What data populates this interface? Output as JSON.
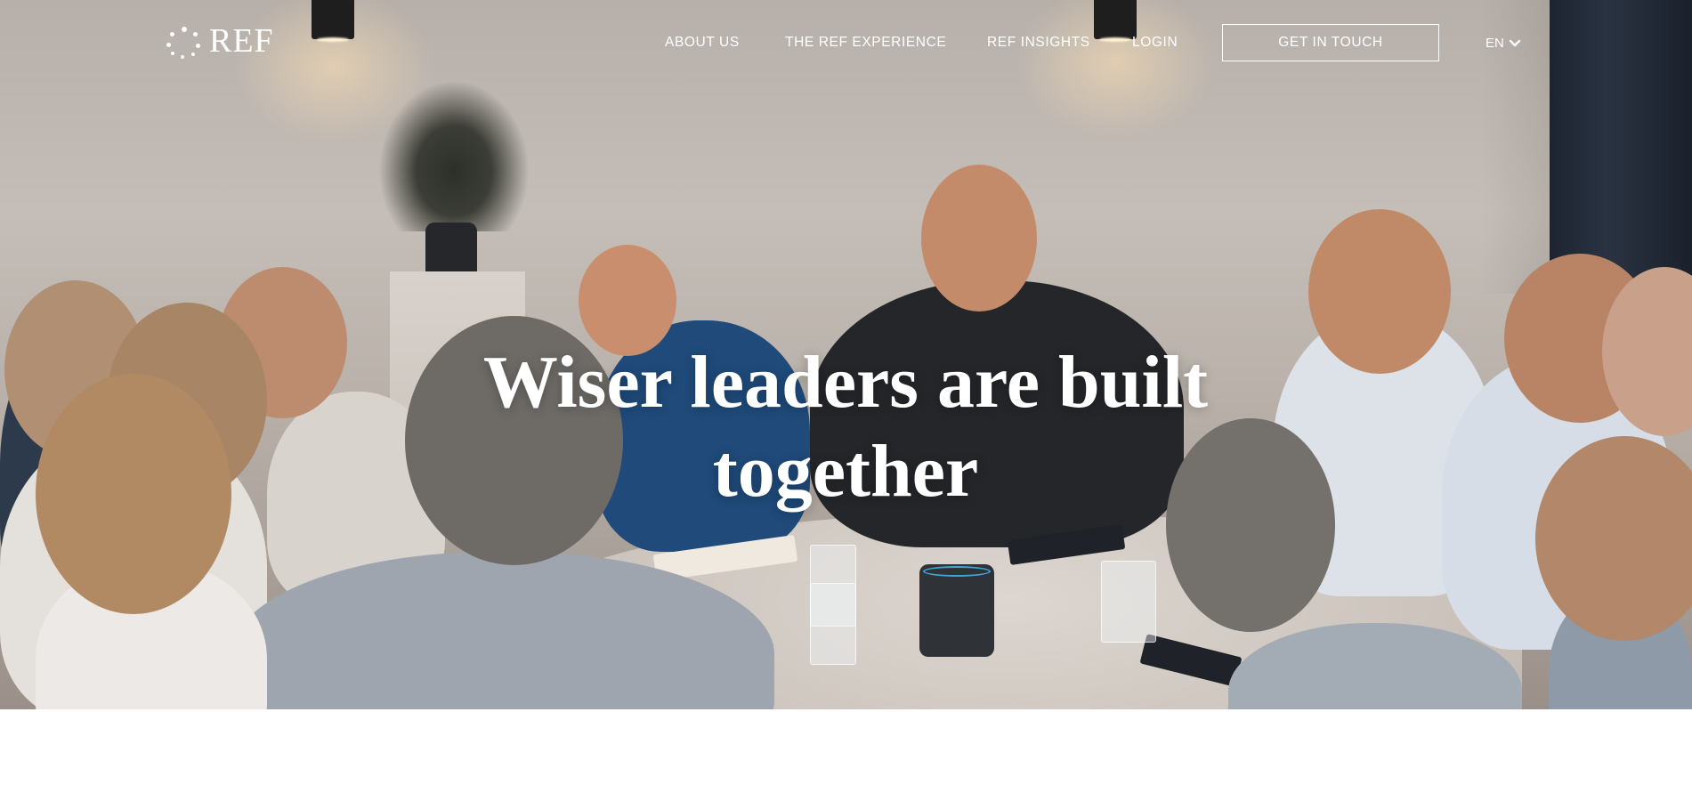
{
  "header": {
    "logo_text": "REF",
    "nav": [
      {
        "label": "ABOUT US"
      },
      {
        "label": "THE REF EXPERIENCE"
      },
      {
        "label": "REF INSIGHTS"
      },
      {
        "label": "LOGIN"
      }
    ],
    "cta_label": "GET IN TOUCH",
    "language": "EN"
  },
  "hero": {
    "headline_line1": "Wiser leaders are built",
    "headline_line2": "together"
  },
  "icons": {
    "logo": "dotted-circle-logo-icon",
    "language_toggle": "chevron-down-icon"
  },
  "colors": {
    "text_on_hero": "#ffffff",
    "page_background": "#ffffff",
    "speaker_ring": "#3fa6d8"
  }
}
